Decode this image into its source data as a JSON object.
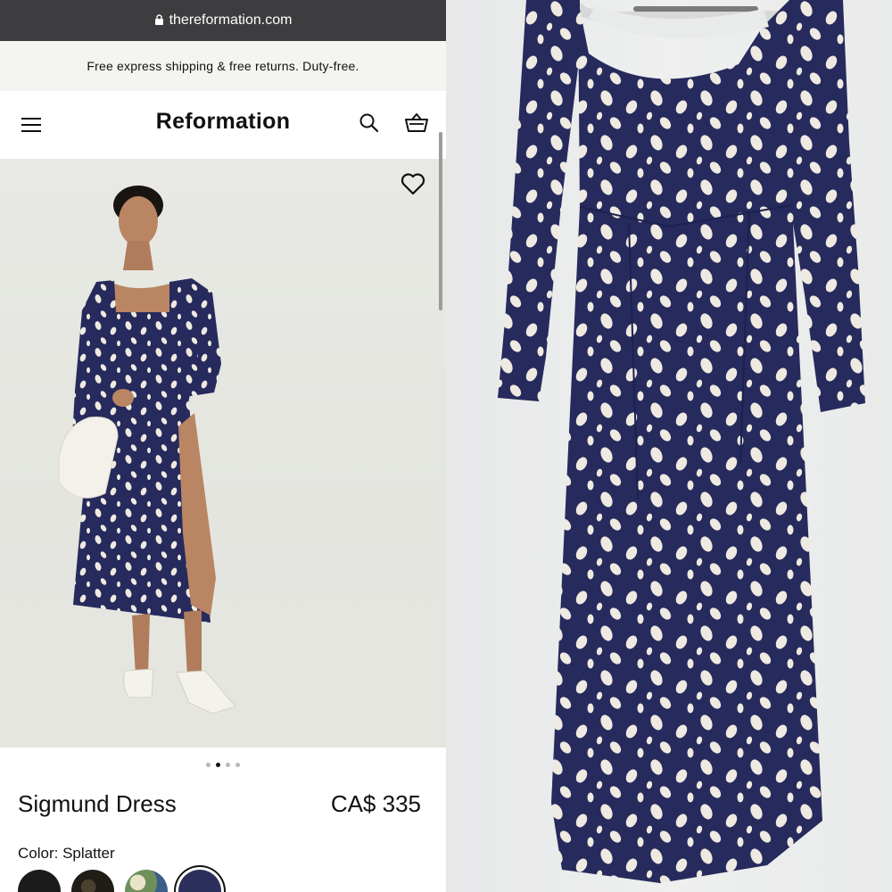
{
  "browser": {
    "url": "thereformation.com"
  },
  "promo": {
    "text": "Free express shipping & free returns. Duty-free."
  },
  "header": {
    "brand": "Reformation"
  },
  "product": {
    "name": "Sigmund Dress",
    "price": "CA$ 335",
    "color_label": "Color: Splatter"
  },
  "gallery": {
    "image_count": 4,
    "active_index": 1
  },
  "swatches": [
    {
      "name": "black",
      "color": "#1b1b1b"
    },
    {
      "name": "black-print",
      "color": "#2a2620"
    },
    {
      "name": "green-floral",
      "color": "#6f8f5a"
    },
    {
      "name": "splatter",
      "color": "#2b2f5c",
      "selected": true
    }
  ],
  "colors": {
    "dress_navy": "#262a5c",
    "spot": "#efeae1",
    "ink": "#111111"
  }
}
